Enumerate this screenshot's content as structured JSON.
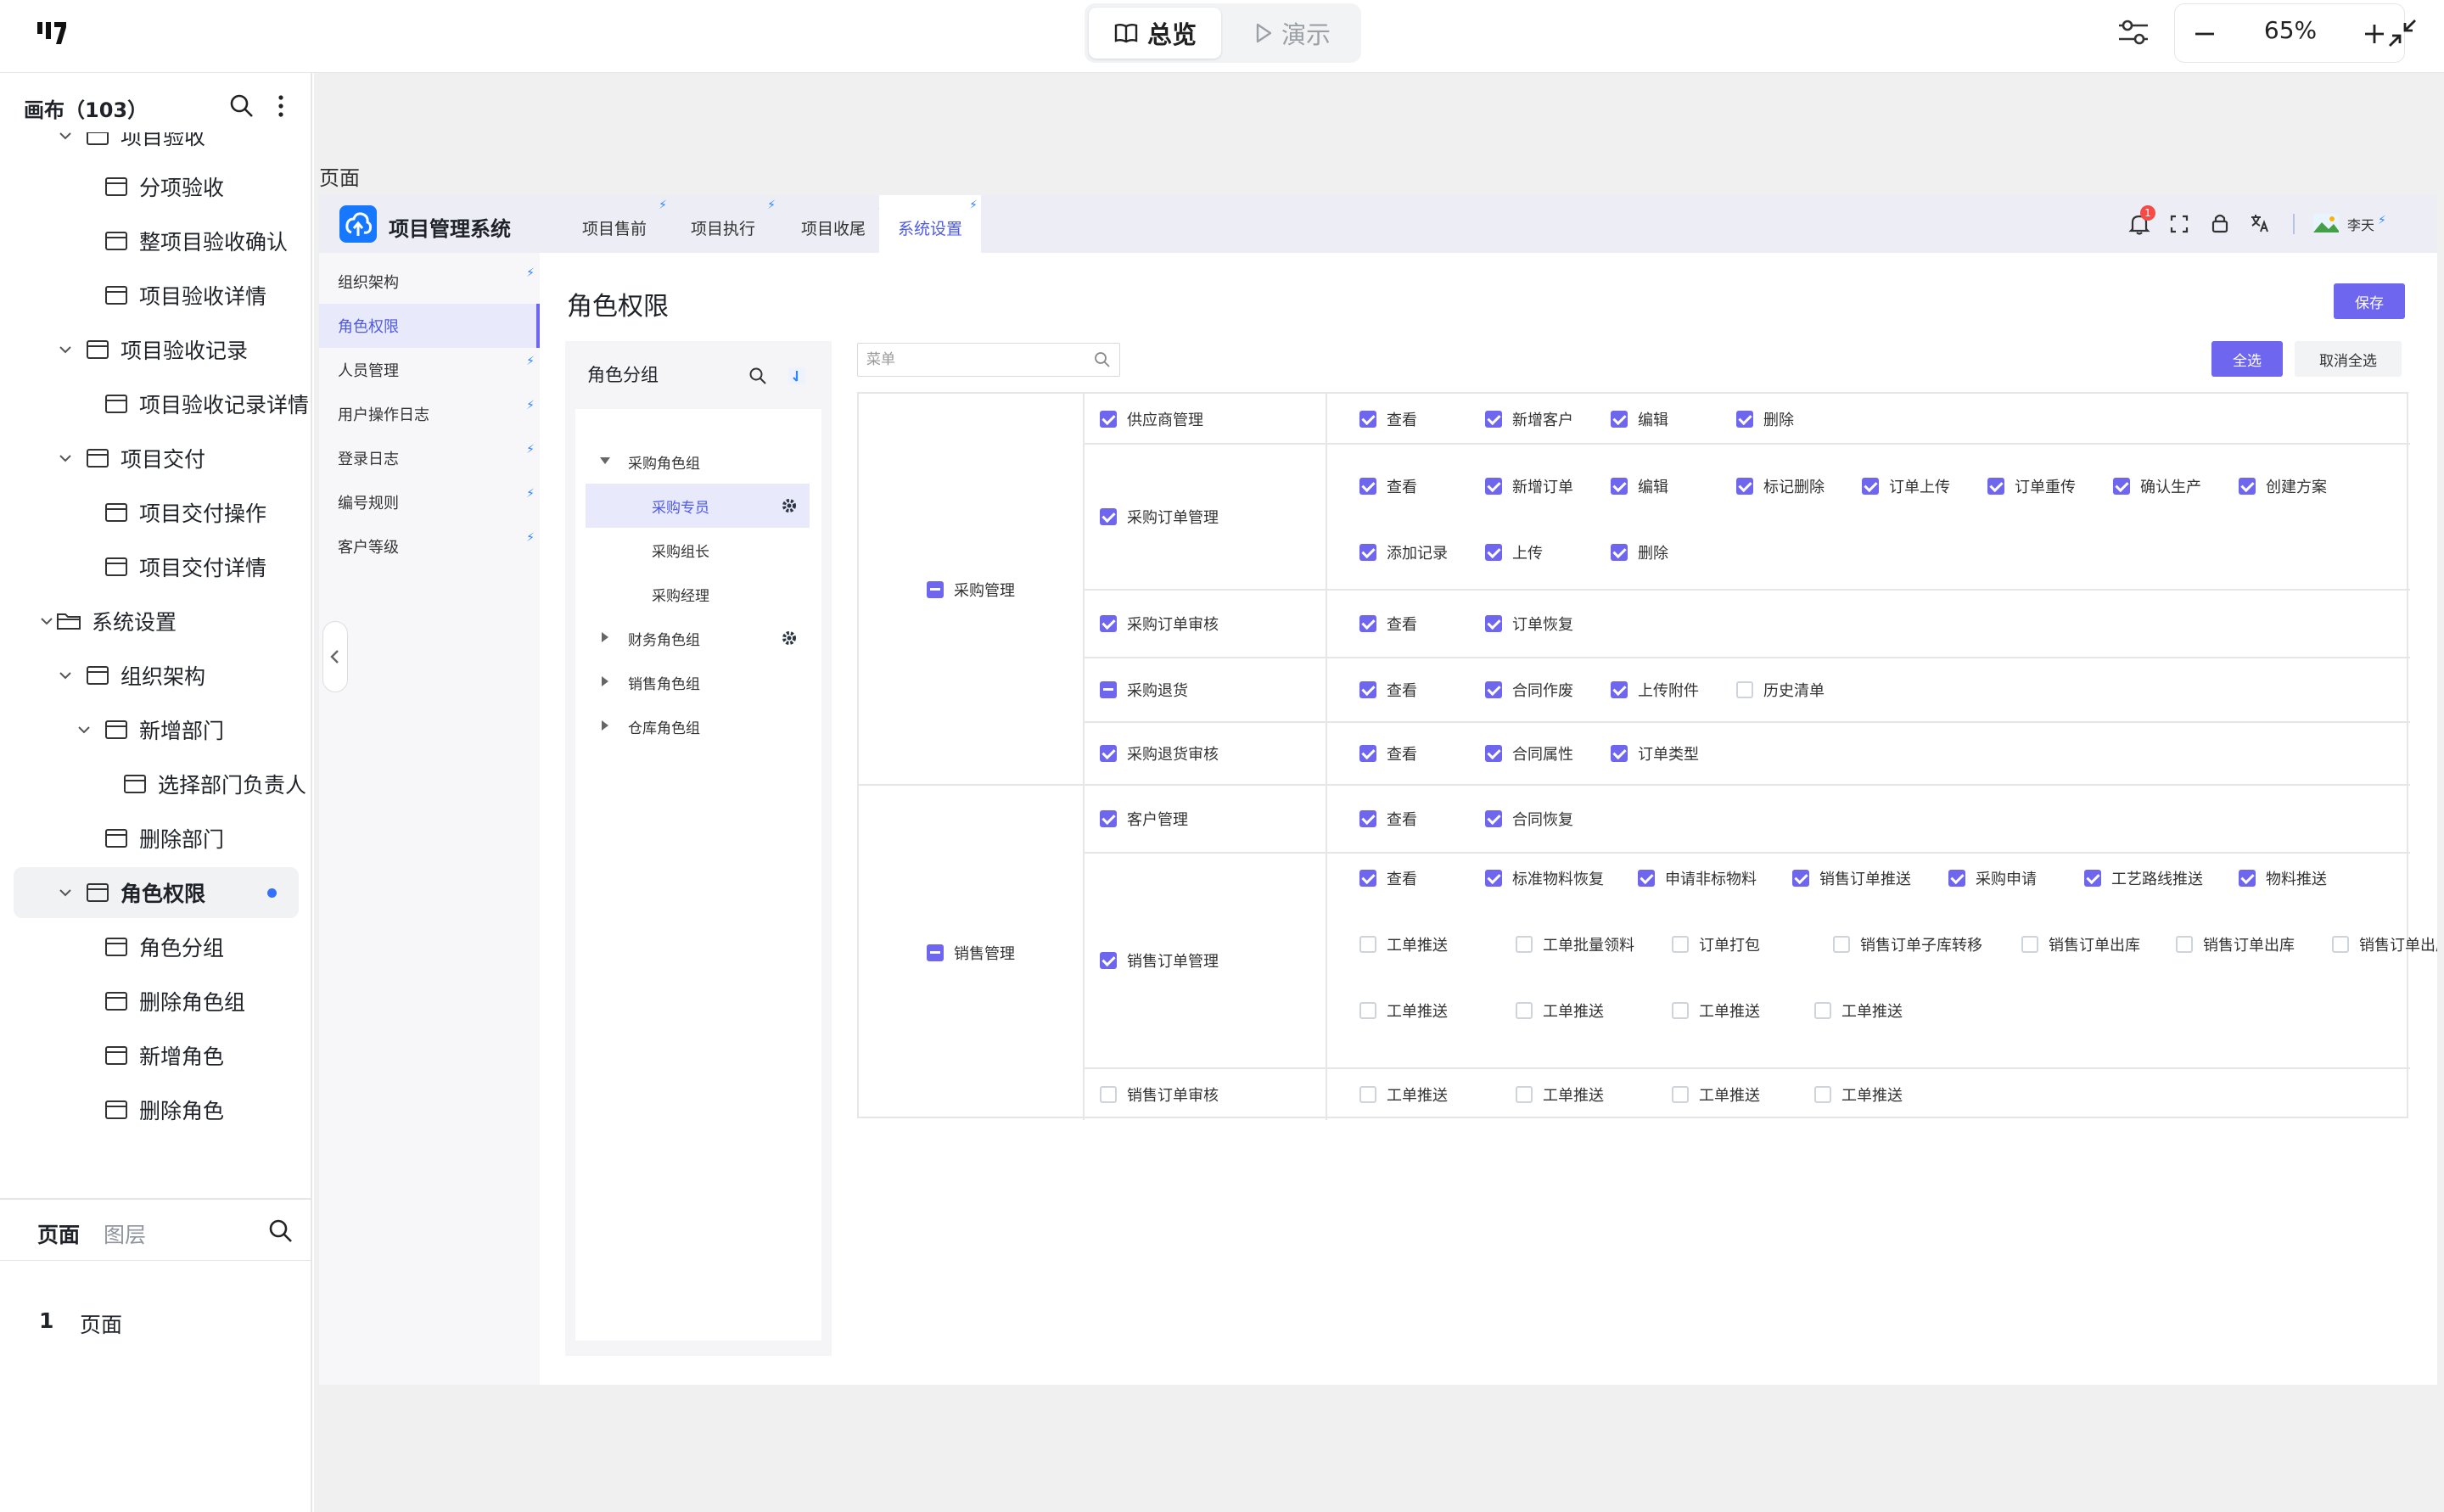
{
  "toolbar": {
    "overview_label": "总览",
    "present_label": "演示",
    "zoom": "65%"
  },
  "left_panel": {
    "title": "画布（103）",
    "tree": [
      {
        "label": "项目验收",
        "level": 1,
        "type": "page",
        "chevron": "down"
      },
      {
        "label": "分项验收",
        "level": 2,
        "type": "page"
      },
      {
        "label": "整项目验收确认",
        "level": 2,
        "type": "page"
      },
      {
        "label": "项目验收详情",
        "level": 2,
        "type": "page"
      },
      {
        "label": "项目验收记录",
        "level": 1,
        "type": "page",
        "chevron": "down"
      },
      {
        "label": "项目验收记录详情",
        "level": 2,
        "type": "page"
      },
      {
        "label": "项目交付",
        "level": 1,
        "type": "page",
        "chevron": "down"
      },
      {
        "label": "项目交付操作",
        "level": 2,
        "type": "page"
      },
      {
        "label": "项目交付详情",
        "level": 2,
        "type": "page"
      },
      {
        "label": "系统设置",
        "level": 0,
        "type": "folder",
        "chevron": "down"
      },
      {
        "label": "组织架构",
        "level": 1,
        "type": "page",
        "chevron": "down"
      },
      {
        "label": "新增部门",
        "level": 2,
        "type": "page",
        "chevron": "down"
      },
      {
        "label": "选择部门负责人",
        "level": 3,
        "type": "page"
      },
      {
        "label": "删除部门",
        "level": 2,
        "type": "page"
      },
      {
        "label": "角色权限",
        "level": 1,
        "type": "page",
        "chevron": "down",
        "selected": true
      },
      {
        "label": "角色分组",
        "level": 2,
        "type": "page"
      },
      {
        "label": "删除角色组",
        "level": 2,
        "type": "page"
      },
      {
        "label": "新增角色",
        "level": 2,
        "type": "page"
      },
      {
        "label": "删除角色",
        "level": 2,
        "type": "page"
      }
    ],
    "tabs": {
      "pages": "页面",
      "layers": "图层"
    },
    "pages": [
      {
        "index": "1",
        "name": "页面"
      }
    ]
  },
  "canvas": {
    "frame_label": "页面"
  },
  "app": {
    "title": "项目管理系统",
    "nav_tabs": [
      "项目售前",
      "项目执行",
      "项目收尾",
      "系统设置"
    ],
    "active_tab": "系统设置",
    "notification_count": "1",
    "user_name": "李天",
    "side_menu": [
      "组织架构",
      "角色权限",
      "人员管理",
      "用户操作日志",
      "登录日志",
      "编号规则",
      "客户等级"
    ],
    "active_menu": "角色权限",
    "page_title": "角色权限",
    "save_label": "保存",
    "roles": {
      "title": "角色分组",
      "groups": [
        {
          "name": "采购角色组",
          "expanded": true,
          "children": [
            "采购专员",
            "采购组长",
            "采购经理"
          ]
        },
        {
          "name": "财务角色组"
        },
        {
          "name": "销售角色组"
        },
        {
          "name": "仓库角色组"
        }
      ],
      "selected_role": "采购专员"
    },
    "search_placeholder": "菜单",
    "select_all_label": "全选",
    "deselect_all_label": "取消全选",
    "permissions": [
      {
        "module": "采购管理",
        "state": "indeterminate",
        "menus": [
          {
            "name": "供应商管理",
            "state": "checked",
            "actions": [
              [
                "查看",
                true
              ],
              [
                "新增客户",
                true
              ],
              [
                "编辑",
                true
              ],
              [
                "删除",
                true
              ]
            ]
          },
          {
            "name": "采购订单管理",
            "state": "checked",
            "actions": [
              [
                "查看",
                true
              ],
              [
                "新增订单",
                true
              ],
              [
                "编辑",
                true
              ],
              [
                "标记删除",
                true
              ],
              [
                "订单上传",
                true
              ],
              [
                "订单重传",
                true
              ],
              [
                "确认生产",
                true
              ],
              [
                "创建方案",
                true
              ],
              [
                "添加记录",
                true
              ],
              [
                "上传",
                true
              ],
              [
                "删除",
                true
              ]
            ]
          },
          {
            "name": "采购订单审核",
            "state": "checked",
            "actions": [
              [
                "查看",
                true
              ],
              [
                "订单恢复",
                true
              ]
            ]
          },
          {
            "name": "采购退货",
            "state": "indeterminate",
            "actions": [
              [
                "查看",
                true
              ],
              [
                "合同作废",
                true
              ],
              [
                "上传附件",
                true
              ],
              [
                "历史清单",
                false
              ]
            ]
          },
          {
            "name": "采购退货审核",
            "state": "checked",
            "actions": [
              [
                "查看",
                true
              ],
              [
                "合同属性",
                true
              ],
              [
                "订单类型",
                true
              ]
            ]
          }
        ]
      },
      {
        "module": "销售管理",
        "state": "indeterminate",
        "menus": [
          {
            "name": "客户管理",
            "state": "checked",
            "actions": [
              [
                "查看",
                true
              ],
              [
                "合同恢复",
                true
              ]
            ]
          },
          {
            "name": "销售订单管理",
            "state": "checked",
            "actions": [
              [
                "查看",
                true
              ],
              [
                "标准物料恢复",
                true
              ],
              [
                "申请非标物料",
                true
              ],
              [
                "销售订单推送",
                true
              ],
              [
                "采购申请",
                true
              ],
              [
                "工艺路线推送",
                true
              ],
              [
                "物料推送",
                true
              ],
              [
                "工单推送",
                false
              ],
              [
                "工单批量领料",
                false
              ],
              [
                "订单打包",
                false
              ],
              [
                "销售订单子库转移",
                false
              ],
              [
                "销售订单出库",
                false
              ],
              [
                "销售订单出库",
                false
              ],
              [
                "销售订单出库",
                false
              ],
              [
                "工单推送",
                false
              ],
              [
                "工单推送",
                false
              ],
              [
                "工单推送",
                false
              ],
              [
                "工单推送",
                false
              ]
            ]
          },
          {
            "name": "销售订单审核",
            "state": "unchecked",
            "actions": [
              [
                "工单推送",
                false
              ],
              [
                "工单推送",
                false
              ],
              [
                "工单推送",
                false
              ],
              [
                "工单推送",
                false
              ]
            ]
          }
        ]
      }
    ]
  },
  "colors": {
    "accent": "#6f66f0",
    "nav_active": "#4e5ae8",
    "bolt": "#2f87ff",
    "brand_blue": "#1677ff"
  }
}
